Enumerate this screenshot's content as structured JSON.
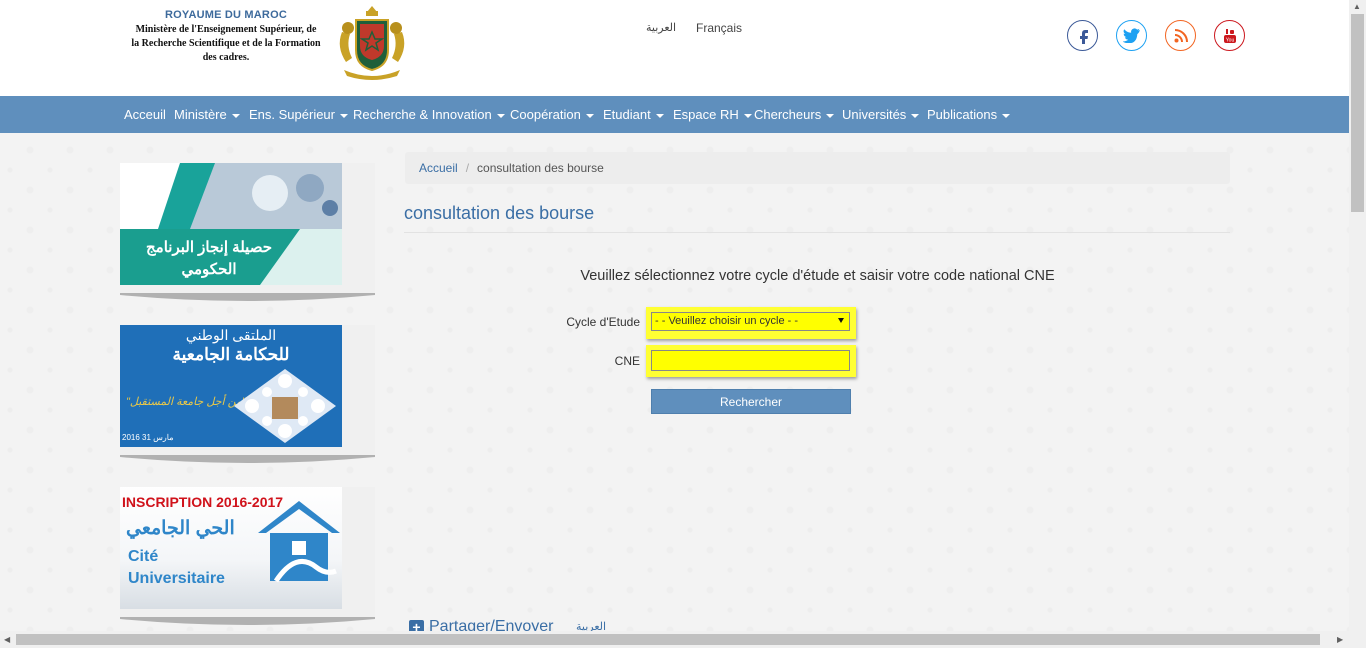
{
  "header": {
    "kingdom": "ROYAUME DU MAROC",
    "ministry_lines": [
      "Ministère de l'Enseignement Supérieur, de",
      "la Recherche Scientifique et de la Formation",
      "des cadres."
    ],
    "lang_ar": "العربية",
    "lang_fr": "Français",
    "social": [
      {
        "name": "facebook",
        "glyph": "f",
        "color": "#3b5998"
      },
      {
        "name": "twitter",
        "glyph": "🐦",
        "color": "#1da1f2"
      },
      {
        "name": "rss",
        "glyph": "◝",
        "color": "#f26522"
      },
      {
        "name": "youtube",
        "glyph": "▶",
        "color": "#cc181e"
      }
    ]
  },
  "nav": {
    "items": [
      {
        "label": "Acceuil",
        "dropdown": false
      },
      {
        "label": "Ministère",
        "dropdown": true
      },
      {
        "label": "Ens. Supérieur",
        "dropdown": true
      },
      {
        "label": "Recherche & Innovation",
        "dropdown": true
      },
      {
        "label": "Coopération",
        "dropdown": true
      },
      {
        "label": "Etudiant",
        "dropdown": true
      },
      {
        "label": "Espace RH",
        "dropdown": true
      },
      {
        "label": "Chercheurs",
        "dropdown": true
      },
      {
        "label": "Universités",
        "dropdown": true
      },
      {
        "label": "Publications",
        "dropdown": true
      }
    ]
  },
  "sidebar": {
    "banner1": {
      "text": "حصيلة إنجاز البرنامج الحكومي"
    },
    "banner2": {
      "title_line1": "الملتقى الوطني",
      "title_line2": "للحكامة الجامعية",
      "slogan": "\"من أجل جامعة المستقبل\"",
      "date": "2016 مارس 31"
    },
    "banner3": {
      "heading": "INSCRIPTION 2016-2017",
      "arabic": "الحي الجامعي",
      "line1": "Cité",
      "line2": "Universitaire"
    }
  },
  "breadcrumb": {
    "home": "Accueil",
    "current": "consultation des bourse"
  },
  "page": {
    "title": "consultation des bourse",
    "instructions": "Veuillez sélectionnez votre cycle d'étude et saisir votre code national CNE"
  },
  "form": {
    "cycle_label": "Cycle d'Etude",
    "cycle_selected": "- - Veuillez choisir un cycle - -",
    "cne_label": "CNE",
    "cne_value": "",
    "submit_label": "Rechercher"
  },
  "share": {
    "label": "Partager/Envoyer",
    "lang_ar": "العربية"
  }
}
